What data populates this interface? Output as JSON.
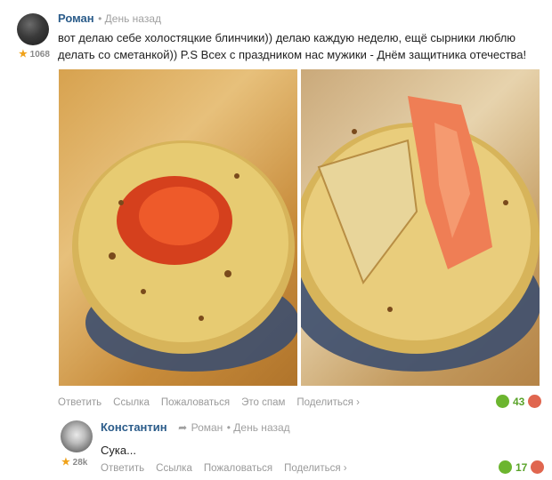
{
  "post": {
    "author": "Роман",
    "time": "День назад",
    "rating": "1068",
    "text": "вот делаю себе холостяцкие блинчики)) делаю каждую неделю, ещё сырники люблю делать со сметанкой)) P.S Всех с праздником нас мужики - Днём защитника отечества!",
    "actions": {
      "reply": "Ответить",
      "link": "Ссылка",
      "complain": "Пожаловаться",
      "spam": "Это спам",
      "share": "Поделиться ›"
    },
    "likes": "43"
  },
  "reply": {
    "author": "Константин",
    "reply_to": "Роман",
    "time": "День назад",
    "rating": "28k",
    "text": "Сука...",
    "actions": {
      "reply": "Ответить",
      "link": "Ссылка",
      "complain": "Пожаловаться",
      "share": "Поделиться ›"
    },
    "likes": "17"
  }
}
